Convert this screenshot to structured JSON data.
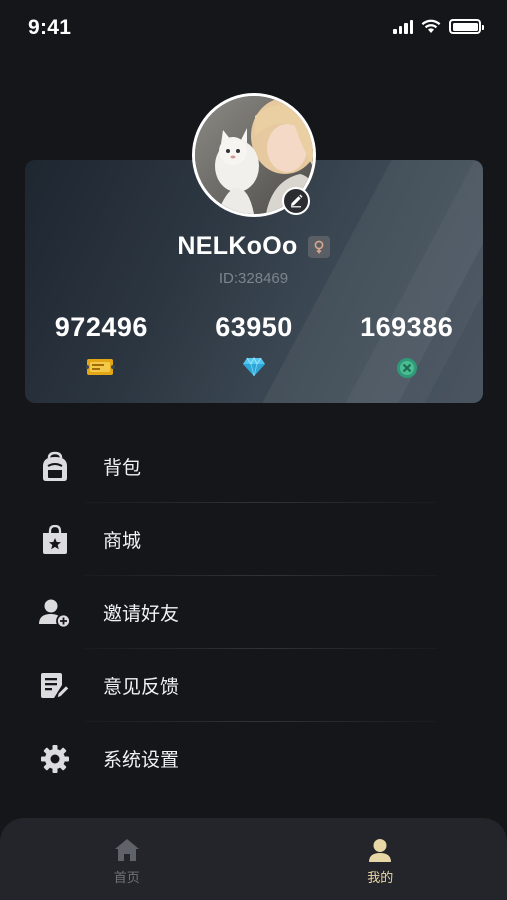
{
  "status_bar": {
    "time": "9:41"
  },
  "profile": {
    "username": "NELKoOo",
    "user_id": "ID:328469",
    "stats": [
      {
        "value": "972496",
        "icon": "ticket-icon"
      },
      {
        "value": "63950",
        "icon": "diamond-icon"
      },
      {
        "value": "169386",
        "icon": "coin-icon"
      }
    ]
  },
  "menu": {
    "items": [
      {
        "label": "背包",
        "icon": "backpack-icon"
      },
      {
        "label": "商城",
        "icon": "shop-bag-icon"
      },
      {
        "label": "邀请好友",
        "icon": "add-friend-icon"
      },
      {
        "label": "意见反馈",
        "icon": "feedback-icon"
      },
      {
        "label": "系统设置",
        "icon": "gear-icon"
      }
    ]
  },
  "tabbar": {
    "tabs": [
      {
        "label": "首页",
        "icon": "home-icon"
      },
      {
        "label": "我的",
        "icon": "user-icon"
      }
    ]
  },
  "colors": {
    "background": "#15161a",
    "accent": "#e8d7a6",
    "card": "#2c3641"
  }
}
